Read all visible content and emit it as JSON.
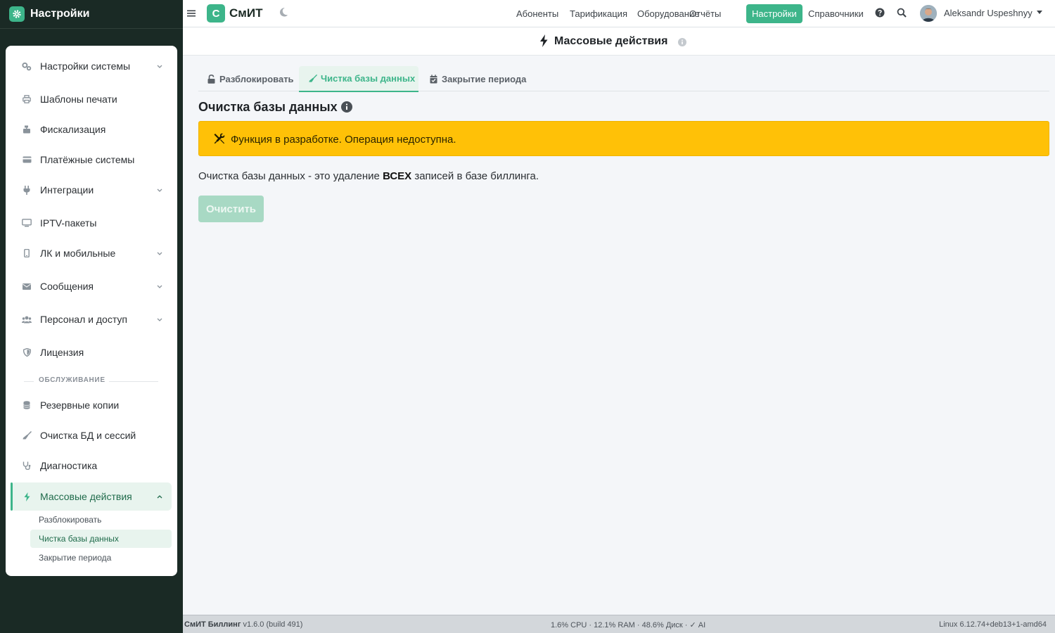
{
  "sidebar": {
    "title": "Настройки",
    "items": [
      {
        "label": "Настройки системы",
        "icon": "gears-icon"
      },
      {
        "label": "Шаблоны печати",
        "icon": "printer-icon"
      },
      {
        "label": "Фискализация",
        "icon": "cash-register-icon"
      },
      {
        "label": "Платёжные системы",
        "icon": "credit-card-icon"
      },
      {
        "label": "Интеграции",
        "icon": "plug-icon"
      },
      {
        "label": "IPTV-пакеты",
        "icon": "tv-icon"
      },
      {
        "label": "ЛК и мобильные",
        "icon": "mobile-icon"
      },
      {
        "label": "Сообщения",
        "icon": "envelope-icon"
      },
      {
        "label": "Персонал и доступ",
        "icon": "users-icon"
      },
      {
        "label": "Лицензия",
        "icon": "shield-icon"
      }
    ],
    "section_label": "ОБСЛУЖИВАНИЕ",
    "maintenance": [
      {
        "label": "Резервные копии",
        "icon": "database-icon"
      },
      {
        "label": "Очистка БД и сессий",
        "icon": "broom-icon"
      },
      {
        "label": "Диагностика",
        "icon": "stethoscope-icon"
      },
      {
        "label": "Массовые действия",
        "icon": "bolt-icon"
      }
    ],
    "subitems": [
      "Разблокировать",
      "Чистка базы данных",
      "Закрытие периода"
    ]
  },
  "topbar": {
    "logo_letter": "С",
    "logo_text": "СмИТ",
    "nav": [
      "Абоненты",
      "Тарификация",
      "Оборудование",
      "Отчёты",
      "Настройки",
      "Справочники"
    ],
    "active_nav": "Настройки",
    "username": "Aleksandr Uspeshnyy"
  },
  "page": {
    "title": "Массовые действия",
    "tabs": [
      "Разблокировать",
      "Чистка базы данных",
      "Закрытие периода"
    ],
    "active_tab": "Чистка базы данных",
    "section_title": "Очистка базы данных",
    "alert_text": "Функция в разработке. Операция недоступна.",
    "desc_before": "Очистка базы данных - это удаление ",
    "desc_bold": "ВСЕХ",
    "desc_after": " записей в базе биллинга.",
    "button_label": "Очистить"
  },
  "footer": {
    "app_name": "СмИТ Биллинг",
    "version": " v1.6.0 (build 491)",
    "stats": "1.6% CPU · 12.1% RAM · 48.6% Диск · ✓ AI",
    "kernel": "Linux 6.12.74+deb13+1-amd64"
  },
  "colors": {
    "accent": "#3db58a",
    "sidebar_bg": "#1a2a25",
    "alert": "#ffc107"
  }
}
